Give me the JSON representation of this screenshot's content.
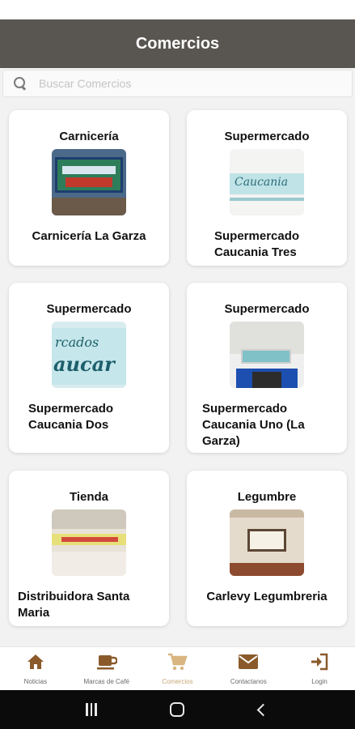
{
  "app_bar": {
    "title": "Comercios"
  },
  "search": {
    "placeholder": "Buscar Comercios",
    "value": ""
  },
  "cards": [
    {
      "category": "Carnicería",
      "name": "Carnicería La Garza"
    },
    {
      "category": "Supermercado",
      "name": "Supermercado Caucania Tres"
    },
    {
      "category": "Supermercado",
      "name": "Supermercado Caucania Dos"
    },
    {
      "category": "Supermercado",
      "name": "Supermercado Caucania Uno (La Garza)"
    },
    {
      "category": "Tienda",
      "name": "Distribuidora Santa Maria"
    },
    {
      "category": "Legumbre",
      "name": "Carlevy Legumbreria"
    }
  ],
  "bottom_nav": {
    "items": [
      {
        "label": "Noticias",
        "icon": "home-icon"
      },
      {
        "label": "Marcas de Café",
        "icon": "coffee-cup-icon"
      },
      {
        "label": "Comercios",
        "icon": "cart-icon",
        "active": true
      },
      {
        "label": "Contactanos",
        "icon": "envelope-icon"
      },
      {
        "label": "Login",
        "icon": "login-icon"
      }
    ]
  },
  "colors": {
    "app_bar": "#595550",
    "accent": "#8a5a2b",
    "active_nav": "#d9b580",
    "background": "#f2f2f2"
  }
}
